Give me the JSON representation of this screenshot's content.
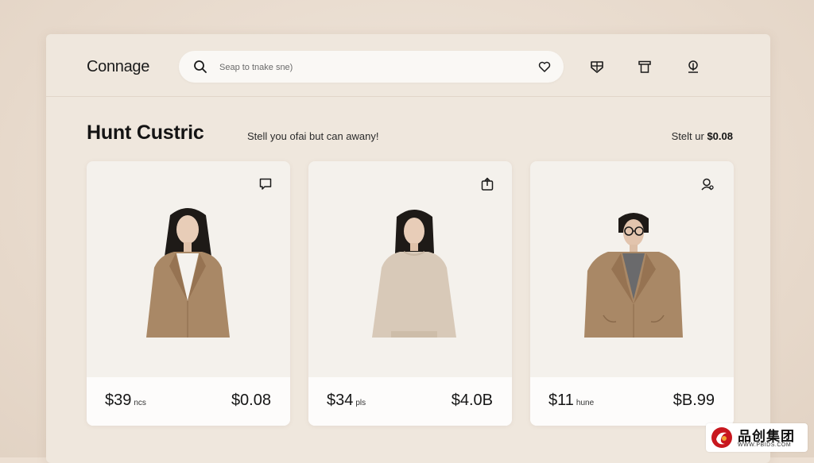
{
  "header": {
    "logo": "Connage",
    "search_placeholder": "Seap to tnake sne)",
    "icons": [
      "search-icon",
      "heart-icon",
      "bag-icon",
      "tag-icon",
      "location-pin-icon"
    ]
  },
  "section": {
    "title": "Hunt Custric",
    "subtitle": "Stell you ofai but can awany!",
    "right_label": "Stelt ur",
    "right_value": "$0.08"
  },
  "products": [
    {
      "icon": "chat-icon",
      "price_left": "$39",
      "unit": "ncs",
      "price_right": "$0.08"
    },
    {
      "icon": "share-icon",
      "price_left": "$34",
      "unit": "pls",
      "price_right": "$4.0B"
    },
    {
      "icon": "user-icon",
      "price_left": "$11",
      "unit": "hune",
      "price_right": "$B.99"
    }
  ],
  "watermark": {
    "main": "品创集团",
    "sub": "WWW.PBIDS.COM"
  },
  "colors": {
    "background": "#ecdfd2",
    "panel": "#efe7dd",
    "card": "#f4f1ec",
    "text": "#141414",
    "coat": "#a98866"
  }
}
